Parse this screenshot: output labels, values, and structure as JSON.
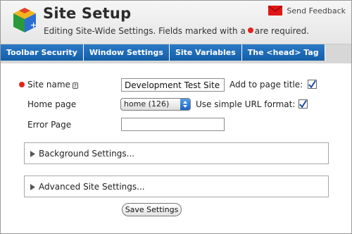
{
  "header": {
    "title": "Site Setup",
    "subtitle_before": "Editing Site-Wide Settings. Fields marked with a",
    "subtitle_after": "are required.",
    "feedback_label": "Send Feedback",
    "required_color": "#e2241b"
  },
  "tabs": [
    {
      "label": "Toolbar Security"
    },
    {
      "label": "Window Settings"
    },
    {
      "label": "Site Variables"
    },
    {
      "label": "The <head> Tag"
    }
  ],
  "form": {
    "site_name": {
      "label": "Site name",
      "value": "Development Test Site",
      "help_icon": "?"
    },
    "add_to_page_title": {
      "label": "Add to page title:",
      "checked": true
    },
    "home_page": {
      "label": "Home page",
      "selected": "home (126)"
    },
    "simple_url": {
      "label": "Use simple URL format:",
      "checked": true
    },
    "error_page": {
      "label": "Error Page",
      "value": ""
    }
  },
  "panels": {
    "background": "Background Settings...",
    "advanced": "Advanced Site Settings..."
  },
  "actions": {
    "save_label": "Save Settings"
  },
  "colors": {
    "tab_blue": "#1d6bb8",
    "accent_red": "#e2241b",
    "check_blue": "#1e4fa3"
  }
}
